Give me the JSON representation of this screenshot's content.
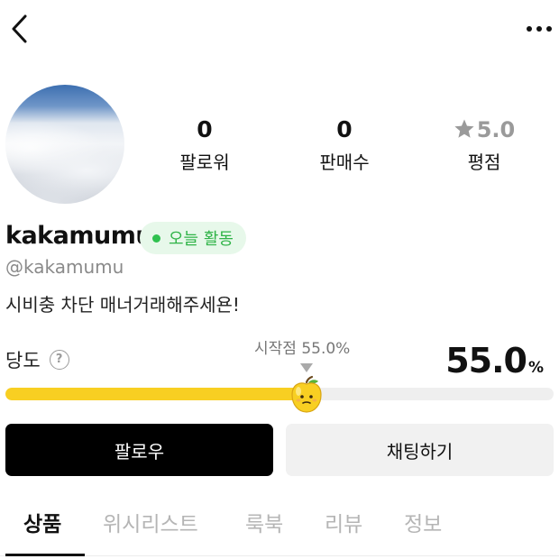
{
  "stats": {
    "followers": {
      "value": "0",
      "label": "팔로워"
    },
    "sales": {
      "value": "0",
      "label": "판매수"
    },
    "rating": {
      "value": "5.0",
      "label": "평점"
    }
  },
  "profile": {
    "username": "kakamumu",
    "active_badge": "오늘 활동",
    "handle": "@kakamumu",
    "bio": "시비충 차단 매너거래해주세욘!"
  },
  "sweetness": {
    "label": "당도",
    "start_label": "시작점 55.0%",
    "value": "55.0",
    "unit": "%",
    "level_percent": 55.0
  },
  "buttons": {
    "follow": "팔로우",
    "chat": "채팅하기"
  },
  "tabs": [
    "상품",
    "위시리스트",
    "룩북",
    "리뷰",
    "정보"
  ],
  "colors": {
    "accent_yellow": "#f8cf22",
    "active_green": "#2fb347",
    "active_badge_bg": "#e7f8ea",
    "primary_button": "#000000"
  },
  "icons": {
    "back": "chevron-left-icon",
    "more": "more-horizontal-icon",
    "star": "star-icon",
    "help": "help-circle-icon",
    "sweetness_character": "apple-character-icon"
  }
}
